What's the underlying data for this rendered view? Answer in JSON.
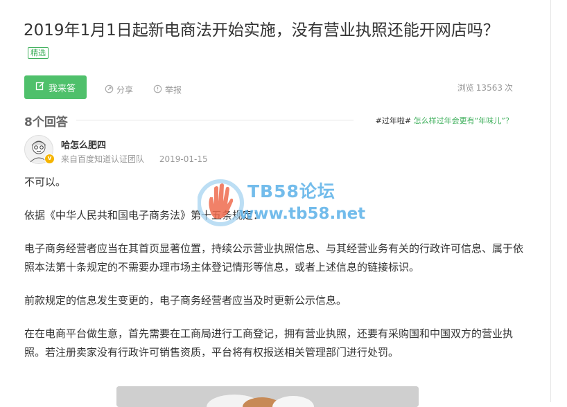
{
  "question": {
    "title": "2019年1月1日起新电商法开始实施，没有营业执照还能开网店吗？",
    "badge": "精选"
  },
  "actions": {
    "answer_button": "我来答",
    "share": "分享",
    "report": "举报",
    "views_label": "浏览",
    "views_count": "13563",
    "views_unit": "次"
  },
  "answers": {
    "count_label": "8个回答",
    "topic_tag": "#过年啦#",
    "topic_link": "怎么样过年会更有“年味儿”？"
  },
  "answer": {
    "author": "哈怎么肥四",
    "source": "来自百度知道认证团队",
    "date": "2019-01-15",
    "paragraphs": [
      "不可以。",
      "依据《中华人民共和国电子商务法》第十五条规定：",
      "电子商务经营者应当在其首页显著位置，持续公示营业执照信息、与其经营业务有关的行政许可信息、属于依照本法第十条规定的不需要办理市场主体登记情形等信息，或者上述信息的链接标识。",
      "前款规定的信息发生变更的，电子商务经营者应当及时更新公示信息。",
      "在在电商平台做生意，首先需要在工商局进行工商登记，拥有营业执照，还要有采购国和中国双方的营业执照。若注册卖家没有行政许可销售资质，平台将有权报送相关管理部门进行处罚。"
    ]
  },
  "watermark": {
    "name": "TB58论坛",
    "url": "www.tb58.net"
  },
  "colors": {
    "accent": "#4fc06b",
    "watermark": "#5bb1e8"
  }
}
